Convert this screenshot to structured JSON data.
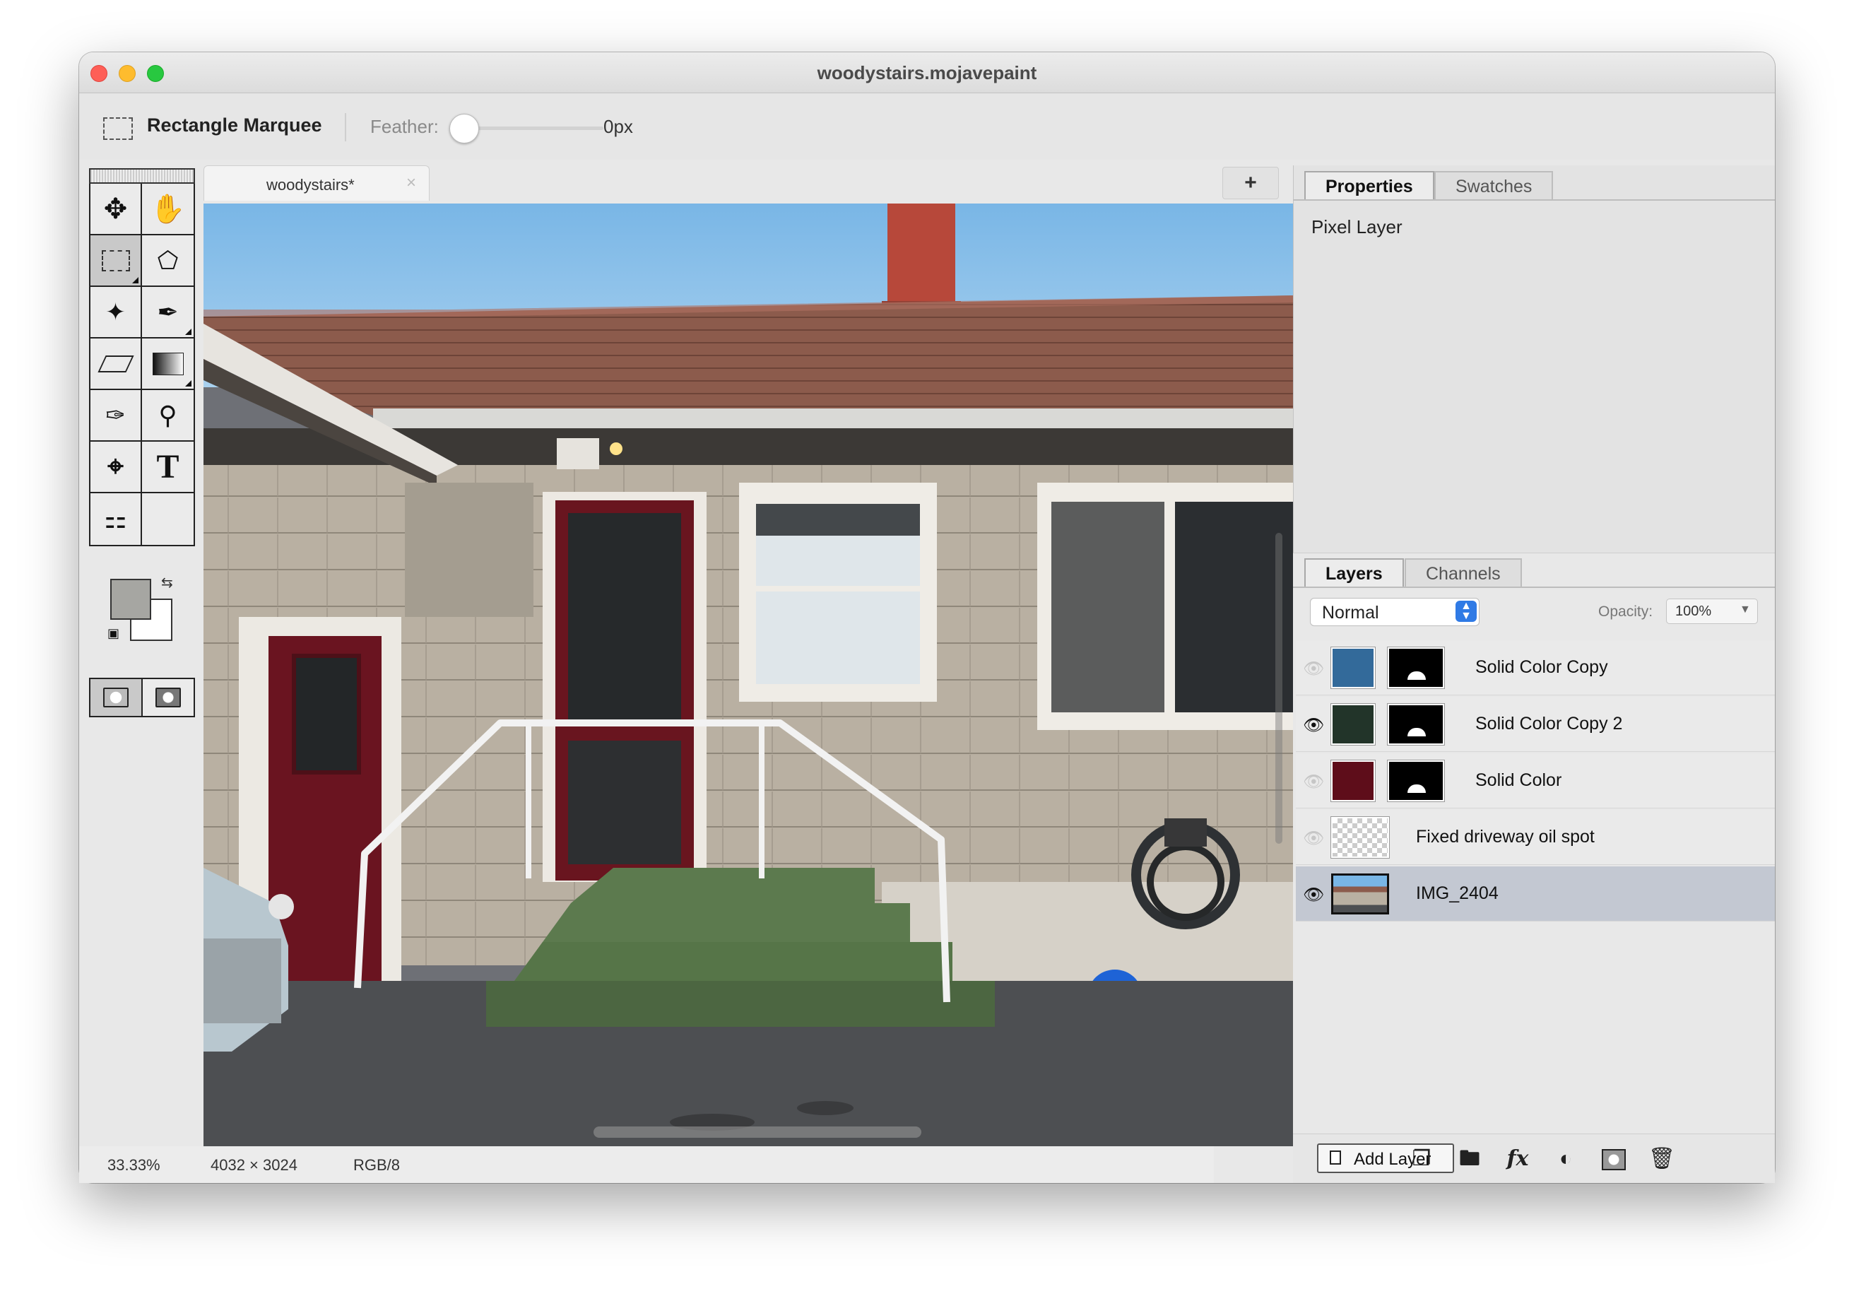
{
  "window": {
    "title": "woodystairs.mojavepaint"
  },
  "options_bar": {
    "tool_name": "Rectangle Marquee",
    "feather_label": "Feather:",
    "feather_value": "0px",
    "feather_level": 0
  },
  "document_tab": {
    "label": "woodystairs",
    "modified": "*"
  },
  "canvas": {
    "add_tab_label": "+"
  },
  "status_bar": {
    "zoom": "33.33%",
    "dimensions": "4032 × 3024",
    "color_mode": "RGB/8"
  },
  "properties_panel": {
    "tabs": [
      "Properties",
      "Swatches"
    ],
    "content": "Pixel Layer"
  },
  "layers_panel": {
    "tabs": [
      "Layers",
      "Channels"
    ],
    "blend_mode": "Normal",
    "opacity_label": "Opacity:",
    "opacity_value": "100%",
    "layers": [
      {
        "name": "Solid Color Copy",
        "visible": false,
        "color": "#336a9a",
        "has_mask": true
      },
      {
        "name": "Solid Color Copy 2",
        "visible": true,
        "color": "#223429",
        "has_mask": true
      },
      {
        "name": "Solid Color",
        "visible": false,
        "color": "#5e0d1a",
        "has_mask": true
      },
      {
        "name": "Fixed driveway oil spot",
        "visible": false,
        "color": "checker",
        "has_mask": false
      },
      {
        "name": "IMG_2404",
        "visible": true,
        "color": "photo",
        "has_mask": false,
        "selected": true
      }
    ],
    "add_layer_label": "Add Layer"
  },
  "tools": [
    "move-tool",
    "hand-tool",
    "rectangle-marquee-tool",
    "lasso-tool",
    "magic-wand-tool",
    "brush-tool",
    "eraser-tool",
    "gradient-tool",
    "eyedropper-tool",
    "zoom-tool",
    "crop-tool",
    "text-tool",
    "clone-stamp-tool",
    "empty-slot"
  ],
  "colors": {
    "foreground": "#a6a6a2",
    "background": "#ffffff",
    "accent": "#2f7ae5"
  }
}
